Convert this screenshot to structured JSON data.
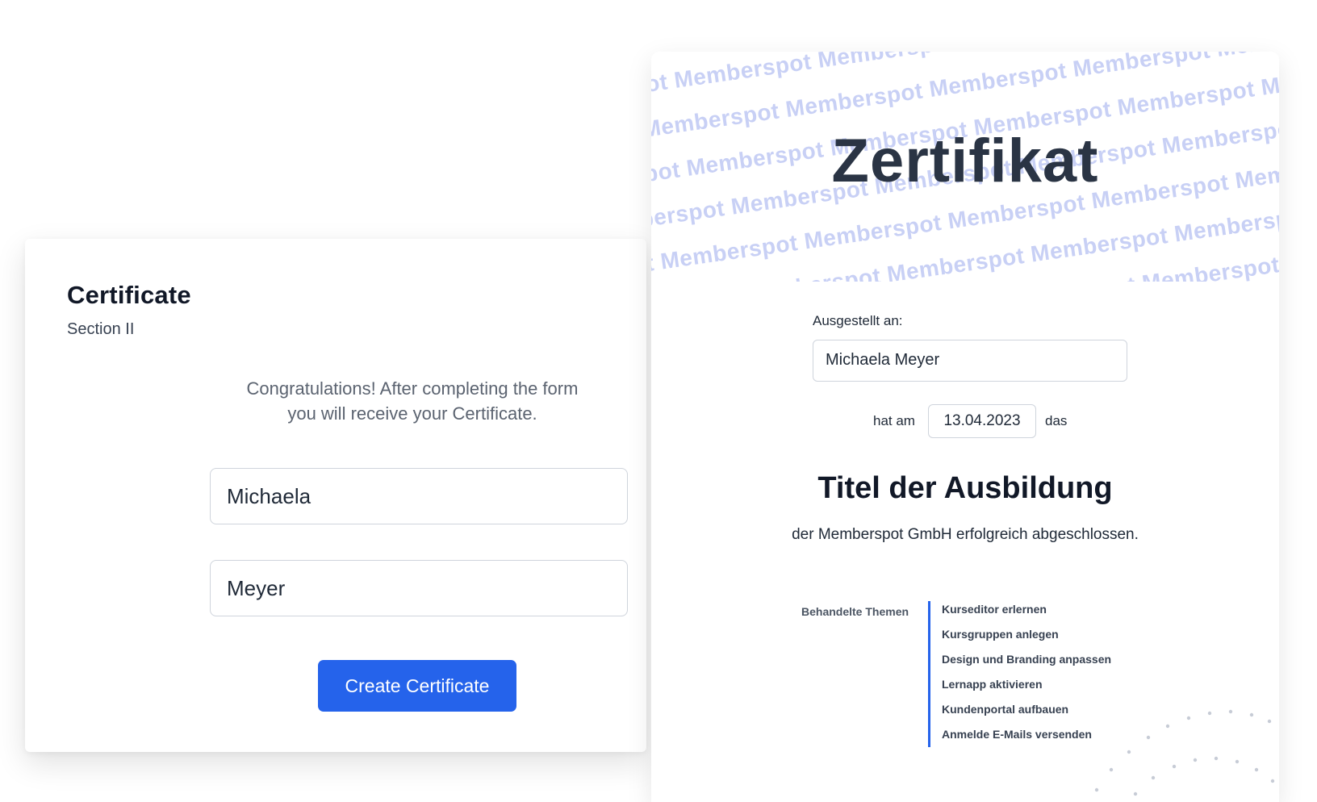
{
  "form": {
    "title": "Certificate",
    "subtitle": "Section II",
    "intro_line1": "Congratulations! After completing the form",
    "intro_line2": "you will receive your Certificate.",
    "first_name_value": "Michaela",
    "last_name_value": "Meyer",
    "submit_label": "Create Certificate",
    "accent_color": "#2563eb"
  },
  "certificate": {
    "watermark_text": "Memberspot",
    "heading": "Zertifikat",
    "issued_label": "Ausgestellt an:",
    "recipient_name": "Michaela Meyer",
    "date_prefix": "hat am",
    "date_value": "13.04.2023",
    "date_suffix": "das",
    "training_title": "Titel der Ausbildung",
    "completion_text": "der Memberspot GmbH erfolgreich abgeschlossen.",
    "topics_label": "Behandelte Themen",
    "topics": [
      "Kurseditor erlernen",
      "Kursgruppen anlegen",
      "Design und Branding anpassen",
      "Lernapp aktivieren",
      "Kundenportal aufbauen",
      "Anmelde E-Mails versenden"
    ],
    "watermark_color": "#c8d0f5",
    "heading_color": "#2a3444"
  }
}
